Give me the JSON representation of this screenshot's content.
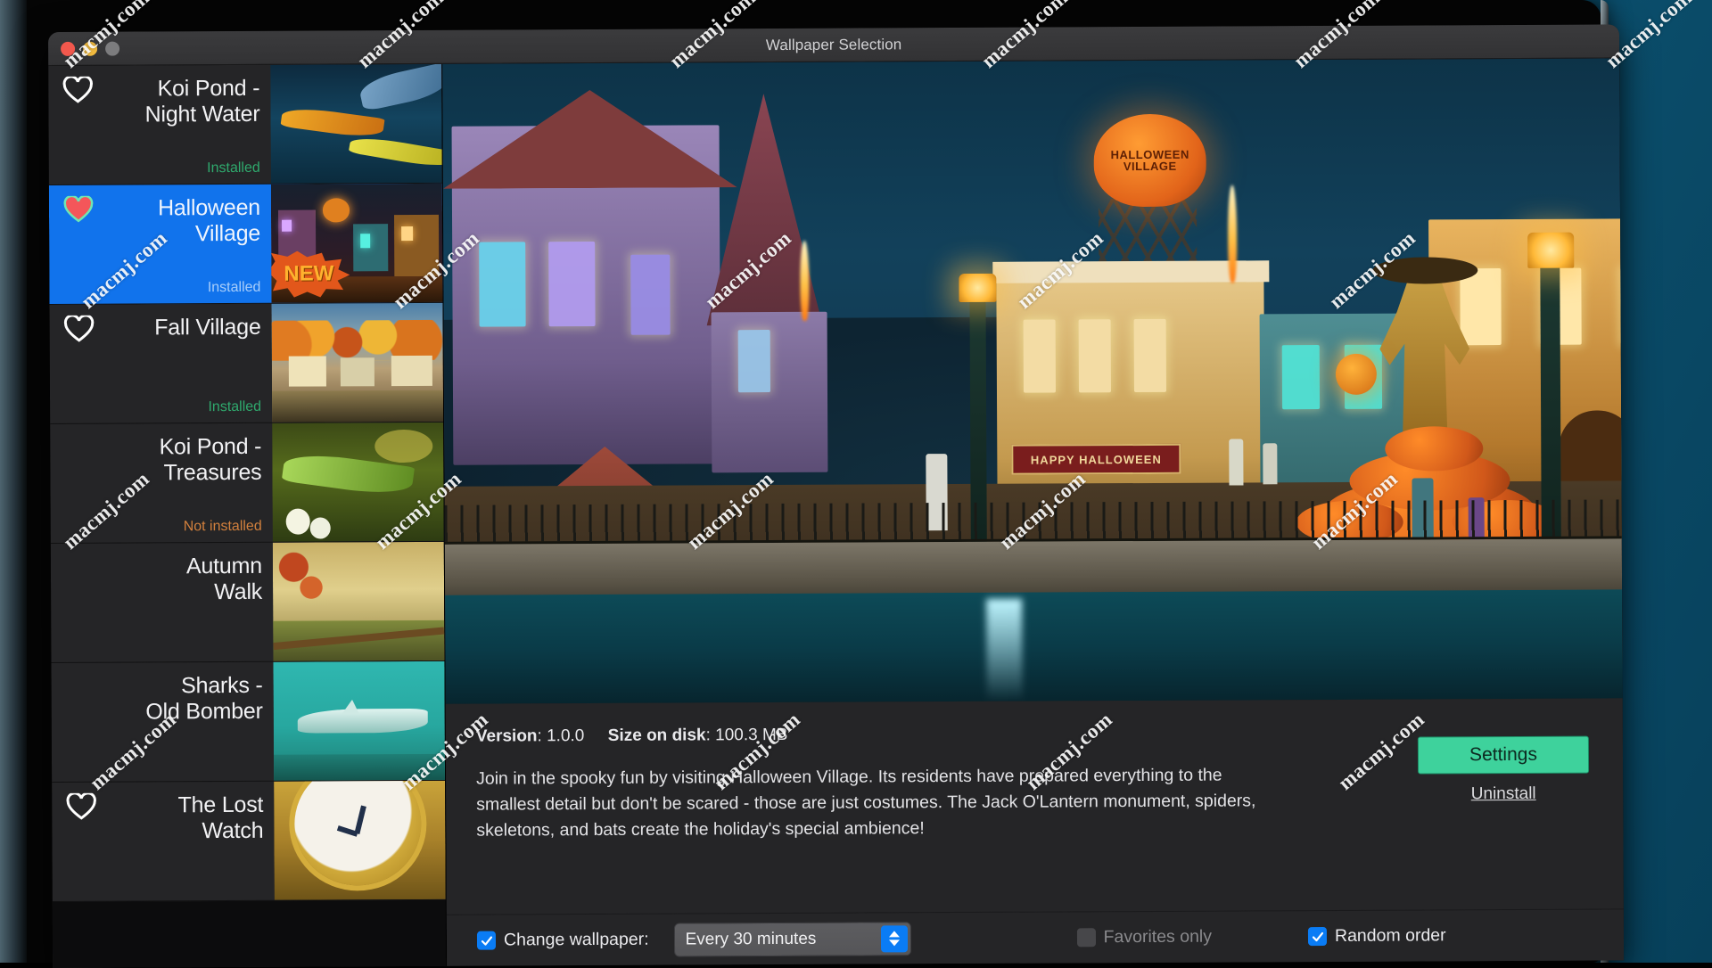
{
  "window": {
    "title": "Wallpaper Selection",
    "traffic_lights": [
      "close",
      "minimize",
      "zoom"
    ]
  },
  "sidebar": {
    "items": [
      {
        "name": "Koi Pond -\nNight Water",
        "title_line1": "Koi Pond -",
        "title_line2": "Night Water",
        "status": "Installed",
        "status_type": "installed",
        "favorite": false,
        "heart": true,
        "selected": false,
        "badge": "",
        "thumb": "koi-night-water"
      },
      {
        "name": "Halloween Village",
        "title_line1": "Halloween",
        "title_line2": "Village",
        "status": "Installed",
        "status_type": "installed",
        "favorite": true,
        "heart": true,
        "selected": true,
        "badge": "NEW",
        "thumb": "halloween-village"
      },
      {
        "name": "Fall Village",
        "title_line1": "Fall Village",
        "title_line2": "",
        "status": "Installed",
        "status_type": "installed",
        "favorite": false,
        "heart": true,
        "selected": false,
        "badge": "",
        "thumb": "fall-village"
      },
      {
        "name": "Koi Pond - Treasures",
        "title_line1": "Koi Pond -",
        "title_line2": "Treasures",
        "status": "Not installed",
        "status_type": "not-installed",
        "favorite": false,
        "heart": false,
        "selected": false,
        "badge": "",
        "thumb": "koi-treasures"
      },
      {
        "name": "Autumn Walk",
        "title_line1": "Autumn",
        "title_line2": "Walk",
        "status": "",
        "status_type": "none",
        "favorite": false,
        "heart": false,
        "selected": false,
        "badge": "",
        "thumb": "autumn-walk"
      },
      {
        "name": "Sharks - Old Bomber",
        "title_line1": "Sharks -",
        "title_line2": "Old Bomber",
        "status": "",
        "status_type": "none",
        "favorite": false,
        "heart": false,
        "selected": false,
        "badge": "",
        "thumb": "sharks-old-bomber"
      },
      {
        "name": "The Lost Watch",
        "title_line1": "The Lost",
        "title_line2": "Watch",
        "status": "",
        "status_type": "none",
        "favorite": false,
        "heart": true,
        "selected": false,
        "badge": "",
        "thumb": "the-lost-watch"
      }
    ]
  },
  "preview": {
    "alt": "Halloween Village wallpaper preview",
    "sign_text": "HALLOWEEN VILLAGE",
    "shop_sign": "HAPPY HALLOWEEN"
  },
  "info": {
    "version_label": "Version",
    "version_value": "1.0.0",
    "size_label": "Size on disk",
    "size_value": "100.3 MB",
    "description": "Join in the spooky fun by visiting Halloween Village. Its residents have prepared everything to the smallest detail but don't be scared - those are just costumes. The Jack O'Lantern monument, spiders, skeletons, and bats create the holiday's special ambience!",
    "settings_label": "Settings",
    "uninstall_label": "Uninstall"
  },
  "toolbar": {
    "change_wallpaper_label": "Change wallpaper:",
    "change_wallpaper_checked": true,
    "interval_value": "Every 30 minutes",
    "interval_options": [
      "Every 30 minutes"
    ],
    "favorites_only_label": "Favorites only",
    "favorites_only_checked": false,
    "favorites_only_disabled": true,
    "random_order_label": "Random order",
    "random_order_checked": true
  },
  "colors": {
    "selection_blue": "#1173ec",
    "installed_green": "#2fa96d",
    "not_installed_orange": "#d2803d",
    "settings_green": "#3ed29c",
    "checkbox_blue": "#0a7cf5",
    "desktop_teal": "#0a4a66"
  },
  "watermark": {
    "text": "macmj.com"
  }
}
